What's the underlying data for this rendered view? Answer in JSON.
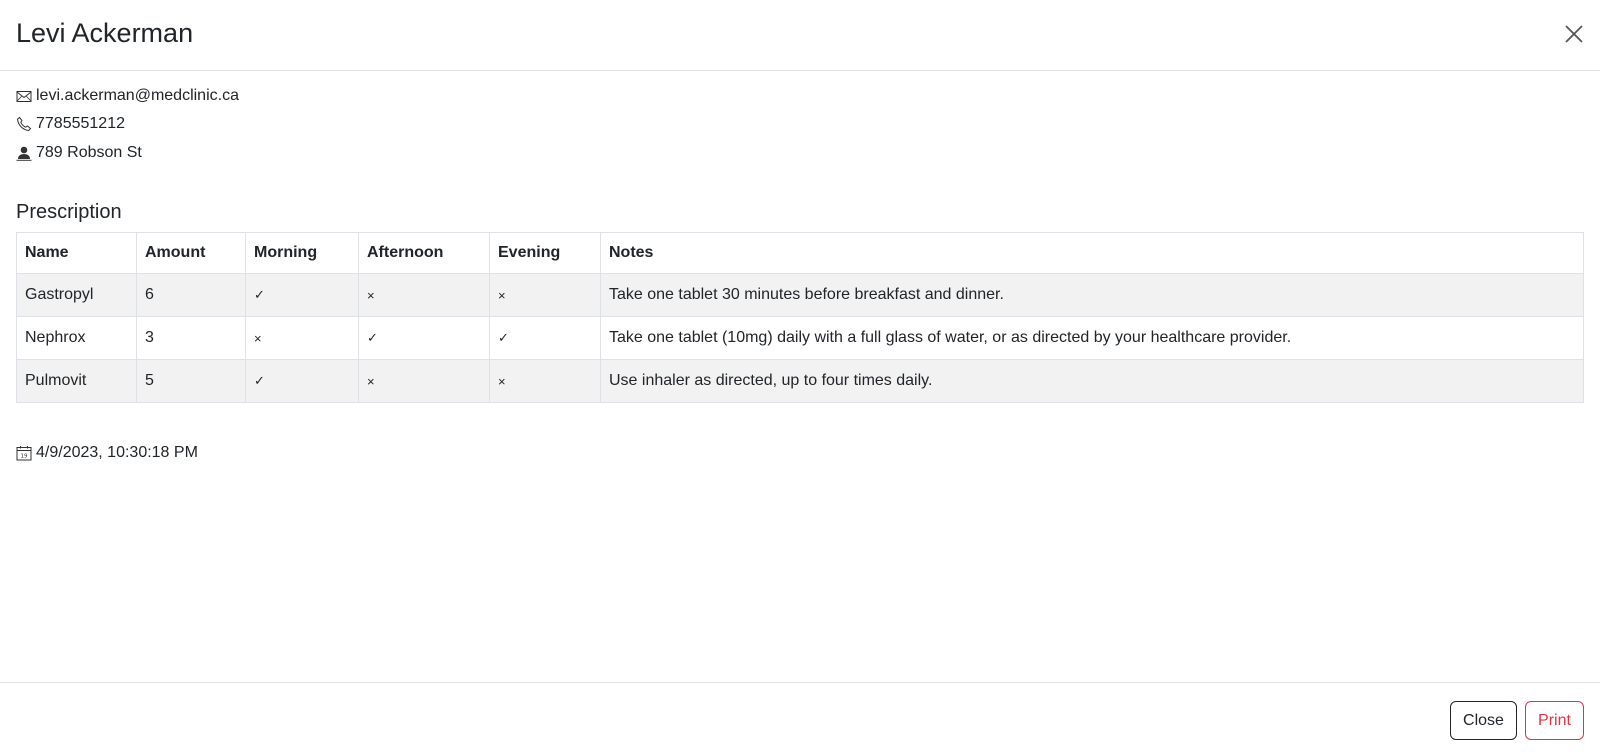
{
  "modal": {
    "title": "Levi Ackerman"
  },
  "contact": {
    "email": "levi.ackerman@medclinic.ca",
    "phone": "7785551212",
    "address": "789 Robson St",
    "icons": [
      "envelope-icon",
      "phone-icon",
      "person-icon"
    ]
  },
  "prescription": {
    "title": "Prescription",
    "columns": [
      "Name",
      "Amount",
      "Morning",
      "Afternoon",
      "Evening",
      "Notes"
    ],
    "rows": [
      {
        "name": "Gastropyl",
        "amount": "6",
        "morning": "✓",
        "afternoon": "×",
        "evening": "×",
        "notes": "Take one tablet 30 minutes before breakfast and dinner."
      },
      {
        "name": "Nephrox",
        "amount": "3",
        "morning": "×",
        "afternoon": "✓",
        "evening": "✓",
        "notes": "Take one tablet (10mg) daily with a full glass of water, or as directed by your healthcare provider."
      },
      {
        "name": "Pulmovit",
        "amount": "5",
        "morning": "✓",
        "afternoon": "×",
        "evening": "×",
        "notes": "Use inhaler as directed, up to four times daily."
      }
    ]
  },
  "timestamp": {
    "value": "4/9/2023, 10:30:18 PM",
    "icon": "calendar-icon"
  },
  "footer": {
    "close_label": "Close",
    "print_label": "Print"
  },
  "colors": {
    "print_accent": "#dc3545",
    "stripe": "#f2f2f2",
    "border": "#dee2e6"
  }
}
